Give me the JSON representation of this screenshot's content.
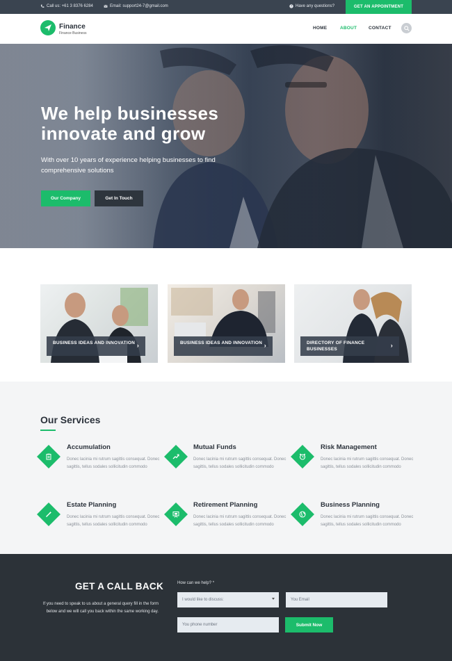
{
  "topbar": {
    "phone": "Call us: +61 3 8376 6284",
    "email": "Email: support24-7@gmail.com",
    "question": "Have any questions?",
    "appointment_label": "GET AN APPOINTMENT"
  },
  "nav": {
    "logo_title": "Finance",
    "logo_subtitle": "Finance Business",
    "links": [
      "HOME",
      "ABOUT",
      "CONTACT"
    ],
    "active": "ABOUT"
  },
  "hero": {
    "title": "We help businesses innovate and grow",
    "subtitle": "With over 10 years of experience helping businesses to find comprehensive solutions",
    "primary_button": "Our Company",
    "secondary_button": "Get In Touch"
  },
  "cards": [
    {
      "label": "BUSINESS IDEAS AND INNOVATION"
    },
    {
      "label": "BUSINESS IDEAS AND INNOVATION"
    },
    {
      "label": "DIRECTORY OF FINANCE BUSINESSES"
    }
  ],
  "services": {
    "title": "Our Services",
    "items": [
      {
        "name": "Accumulation",
        "desc": "Donec lacinia mi rutrum sagittis consequat. Donec sagittis, tellus sodales sollicitudin commodo",
        "icon": "clipboard-icon"
      },
      {
        "name": "Mutual Funds",
        "desc": "Donec lacinia mi rutrum sagittis consequat. Donec sagittis, tellus sodales sollicitudin commodo",
        "icon": "trend-icon"
      },
      {
        "name": "Risk Management",
        "desc": "Donec lacinia mi rutrum sagittis consequat. Donec sagittis, tellus sodales sollicitudin commodo",
        "icon": "alarm-clock-icon"
      },
      {
        "name": "Estate Planning",
        "desc": "Donec lacinia mi rutrum sagittis consequat. Donec sagittis, tellus sodales sollicitudin commodo",
        "icon": "magic-wand-icon"
      },
      {
        "name": "Retirement Planning",
        "desc": "Donec lacinia mi rutrum sagittis consequat. Donec sagittis, tellus sodales sollicitudin commodo",
        "icon": "presentation-icon"
      },
      {
        "name": "Business Planning",
        "desc": "Donec lacinia mi rutrum sagittis consequat. Donec sagittis, tellus sodales sollicitudin commodo",
        "icon": "globe-icon"
      }
    ]
  },
  "callback": {
    "title": "GET A CALL BACK",
    "text": "If you need to speak to us about a general query fill in the form below and we will call you back within the same working day.",
    "help_label": "How can we help? *",
    "select_value": "I would like to discuss:",
    "email_placeholder": "You Email",
    "phone_placeholder": "You phone number",
    "submit_label": "Submit Now"
  },
  "colors": {
    "accent": "#1cbc6b",
    "dark": "#2c3238",
    "topbar": "#3a4450"
  }
}
